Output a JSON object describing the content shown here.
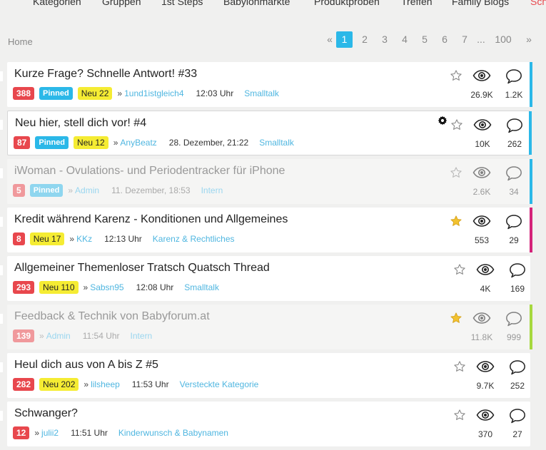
{
  "top_nav": [
    "Kategorien",
    "Gruppen",
    "1st Steps",
    "Babylonmärkte",
    "Produktproben",
    "Treffen",
    "Family Blogs",
    "Sch"
  ],
  "breadcrumb": "Home",
  "pagination": {
    "prev": "«",
    "pages": [
      "1",
      "2",
      "3",
      "4",
      "5",
      "6",
      "7"
    ],
    "ellipsis": "...",
    "last": "100",
    "next": "»",
    "active": "1"
  },
  "colors": {
    "accent": "#2bb8e8",
    "count_red": "#e8474d",
    "new_yellow": "#f5ec33",
    "pink": "#d4237a",
    "green": "#a6d83e"
  },
  "threads": [
    {
      "title": "Kurze Frage? Schnelle Antwort! #33",
      "count": "388",
      "pinned": "Pinned",
      "new": "Neu 22",
      "arrow": "»",
      "user": "1und1istgleich4",
      "time": "12:03 Uhr",
      "category": "Smalltalk",
      "views": "26.9K",
      "replies": "1.2K",
      "starred": false
    },
    {
      "title": "Neu hier, stell dich vor! #4",
      "count": "87",
      "pinned": "Pinned",
      "new": "Neu 12",
      "arrow": "»",
      "user": "AnyBeatz",
      "time": "28. Dezember, 21:22",
      "category": "Smalltalk",
      "views": "10K",
      "replies": "262",
      "starred": false
    },
    {
      "title": "iWoman - Ovulations- und Periodentracker für iPhone",
      "count": "5",
      "pinned": "Pinned",
      "new": "",
      "arrow": "»",
      "user": "Admin",
      "time": "11. Dezember, 18:53",
      "category": "Intern",
      "views": "2.6K",
      "replies": "34",
      "starred": false
    },
    {
      "title": "Kredit während Karenz - Konditionen und Allgemeines",
      "count": "8",
      "pinned": "",
      "new": "Neu 17",
      "arrow": "»",
      "user": "KKz",
      "time": "12:13 Uhr",
      "category": "Karenz & Rechtliches",
      "views": "553",
      "replies": "29",
      "starred": true
    },
    {
      "title": "Allgemeiner Themenloser Tratsch Quatsch Thread",
      "count": "293",
      "pinned": "",
      "new": "Neu 110",
      "arrow": "»",
      "user": "Sabsn95",
      "time": "12:08 Uhr",
      "category": "Smalltalk",
      "views": "4K",
      "replies": "169",
      "starred": false
    },
    {
      "title": "Feedback & Technik von Babyforum.at",
      "count": "139",
      "pinned": "",
      "new": "",
      "arrow": "»",
      "user": "Admin",
      "time": "11:54 Uhr",
      "category": "Intern",
      "views": "11.8K",
      "replies": "999",
      "starred": true
    },
    {
      "title": "Heul dich aus von A bis Z #5",
      "count": "282",
      "pinned": "",
      "new": "Neu 202",
      "arrow": "»",
      "user": "lilsheep",
      "time": "11:53 Uhr",
      "category": "Versteckte Kategorie",
      "views": "9.7K",
      "replies": "252",
      "starred": false
    },
    {
      "title": "Schwanger?",
      "count": "12",
      "pinned": "",
      "new": "",
      "arrow": "»",
      "user": "julii2",
      "time": "11:51 Uhr",
      "category": "Kinderwunsch & Babynamen",
      "views": "370",
      "replies": "27",
      "starred": false
    }
  ]
}
